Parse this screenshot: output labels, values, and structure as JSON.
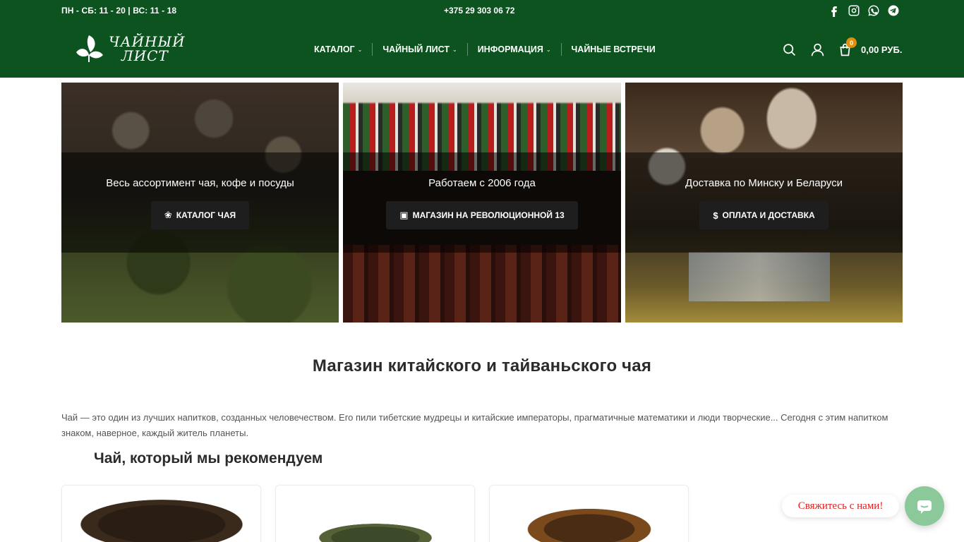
{
  "topbar": {
    "hours": "ПН - СБ: 11 - 20 | ВС: 11 - 18",
    "phone": "+375 29 303 06 72",
    "socials": [
      "facebook-icon",
      "instagram-icon",
      "whatsapp-icon",
      "telegram-icon"
    ]
  },
  "logo": {
    "line1": "ЧАЙНЫЙ",
    "line2": "ЛИСТ"
  },
  "nav": {
    "items": [
      {
        "label": "КАТАЛОГ",
        "has_dropdown": true
      },
      {
        "label": "ЧАЙНЫЙ ЛИСТ",
        "has_dropdown": true
      },
      {
        "label": "ИНФОРМАЦИЯ",
        "has_dropdown": true
      },
      {
        "label": "ЧАЙНЫЕ ВСТРЕЧИ",
        "has_dropdown": false
      }
    ]
  },
  "header_tools": {
    "cart_count": "0",
    "cart_total": "0,00 РУБ."
  },
  "banners": [
    {
      "title": "Весь ассортимент чая, кофе и посуды",
      "button": "КАТАЛОГ ЧАЯ",
      "icon": "leaf-icon"
    },
    {
      "title": "Работаем с 2006 года",
      "button": "МАГАЗИН НА РЕВОЛЮЦИОННОЙ 13",
      "icon": "store-icon"
    },
    {
      "title": "Доставка по Минску и Беларуси",
      "button": "ОПЛАТА И ДОСТАВКА",
      "icon": "dollar-icon"
    }
  ],
  "main": {
    "title": "Магазин китайского и тайваньского чая",
    "intro": "Чай — это один из лучших напитков, созданных человечеством. Его пили тибетские мудрецы и китайские императоры, прагматичные математики и люди творческие... Сегодня с этим напитком знаком, наверное, каждый житель планеты.",
    "recommend_title": "Чай, который мы рекомендуем"
  },
  "chat": {
    "label": "Свяжитесь с нами!"
  },
  "colors": {
    "header_bg": "#0d5320",
    "cart_badge": "#e08e0b",
    "chat_button": "#8bc99a",
    "chat_label_text": "#e02020"
  }
}
